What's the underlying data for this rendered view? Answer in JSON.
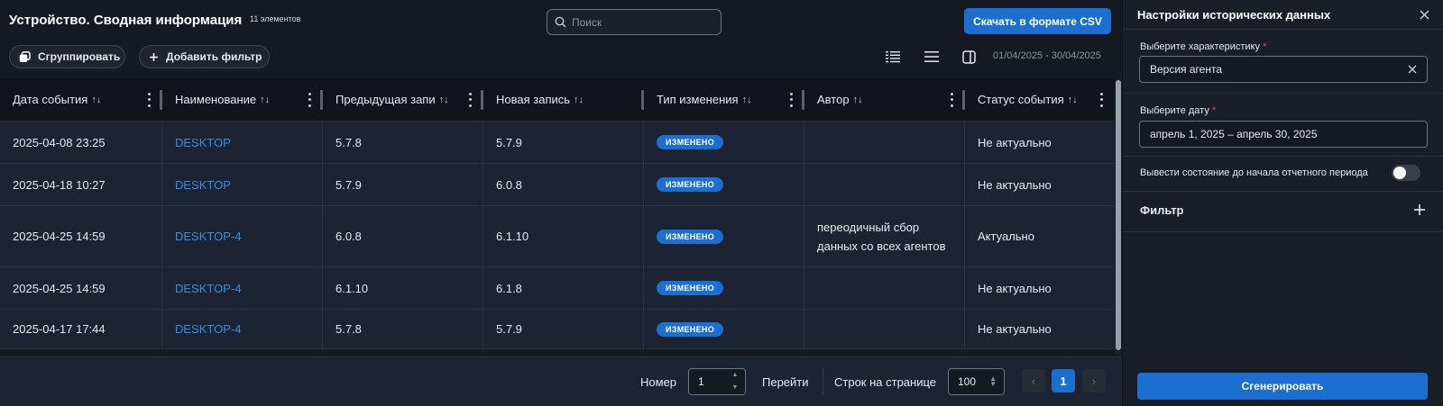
{
  "header": {
    "title": "Устройство. Сводная информация",
    "count": "11 элементов",
    "search_placeholder": "Поиск",
    "csv_button": "Скачать в формате CSV",
    "group_button": "Сгруппировать",
    "add_filter_button": "Добавить фильтр",
    "date_range": "01/04/2025 - 30/04/2025"
  },
  "table": {
    "columns": [
      "Дата события",
      "Наименование",
      "Предыдущая запи",
      "Новая запись",
      "Тип изменения",
      "Автор",
      "Статус события"
    ],
    "sort_glyph": "↑↓",
    "rows": [
      {
        "date": "2025-04-08 23:25",
        "name": "DESKTOP",
        "prev": "5.7.8",
        "new": "5.7.9",
        "type": "ИЗМЕНЕНО",
        "author": "",
        "status": "Не актуально"
      },
      {
        "date": "2025-04-18 10:27",
        "name": "DESKTOP",
        "prev": "5.7.9",
        "new": "6.0.8",
        "type": "ИЗМЕНЕНО",
        "author": "",
        "status": "Не актуально"
      },
      {
        "date": "2025-04-25 14:59",
        "name": "DESKTOP-4",
        "prev": "6.0.8",
        "new": "6.1.10",
        "type": "ИЗМЕНЕНО",
        "author": "переодичный сбор данных со всех агентов",
        "status": "Актуально"
      },
      {
        "date": "2025-04-25 14:59",
        "name": "DESKTOP-4",
        "prev": "6.1.10",
        "new": "6.1.8",
        "type": "ИЗМЕНЕНО",
        "author": "",
        "status": "Не актуально"
      },
      {
        "date": "2025-04-17 17:44",
        "name": "DESKTOP-4",
        "prev": "5.7.8",
        "new": "5.7.9",
        "type": "ИЗМЕНЕНО",
        "author": "",
        "status": "Не актуально"
      }
    ]
  },
  "pagination": {
    "page_label": "Номер",
    "page_value": "1",
    "go_label": "Перейти",
    "rows_label": "Строк на странице",
    "rows_value": "100",
    "current_page": "1",
    "prev": "‹",
    "next": "›"
  },
  "panel": {
    "title": "Настройки исторических данных",
    "characteristic_label": "Выберите характеристику",
    "characteristic_value": "Версия агента",
    "date_label": "Выберите дату",
    "date_value": "апрель 1, 2025 – апрель 30, 2025",
    "toggle_label": "Вывести состояние до начала отчетного периода",
    "toggle_on": false,
    "filter_title": "Фильтр",
    "generate_button": "Сгенерировать",
    "required_mark": "*"
  },
  "colors": {
    "accent": "#1c6fd0",
    "link": "#3a8de0",
    "required": "#e24a4a",
    "row_bg": "#1c2433",
    "header_bg": "#11141a"
  }
}
